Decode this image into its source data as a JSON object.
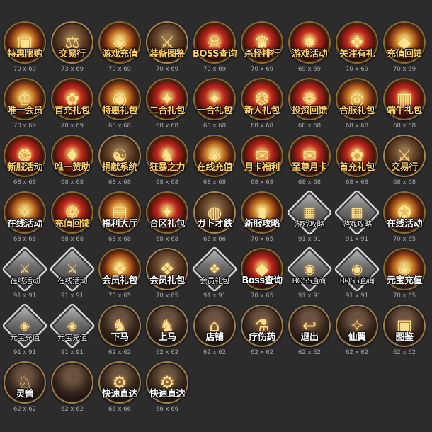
{
  "icons": [
    {
      "label": "特惠限购",
      "size": "70 x 69",
      "style": "gold",
      "glyph": "▣",
      "label_style": "gold"
    },
    {
      "label": "交易行",
      "size": "73 x 69",
      "style": "bronze",
      "glyph": "⚖",
      "label_style": "gold"
    },
    {
      "label": "游戏充值",
      "size": "70 x 69",
      "style": "gold",
      "glyph": "◈",
      "label_style": "gold"
    },
    {
      "label": "装备图鉴",
      "size": "70 x 69",
      "style": "bronze",
      "glyph": "⚔",
      "label_style": "gold"
    },
    {
      "label": "BOSS查询",
      "size": "70 x 69",
      "style": "red",
      "glyph": "☠",
      "label_style": "gold"
    },
    {
      "label": "杀怪排行",
      "size": "70 x 69",
      "style": "red",
      "glyph": "♛",
      "label_style": "gold"
    },
    {
      "label": "游戏活动",
      "size": "69 x 69",
      "style": "red",
      "glyph": "✹",
      "label_style": "gold"
    },
    {
      "label": "关注有礼",
      "size": "70 x 69",
      "style": "red",
      "glyph": "❖",
      "label_style": "gold"
    },
    {
      "label": "充值回馈",
      "size": "70 x 69",
      "style": "gold",
      "glyph": "◆",
      "label_style": "gold"
    },
    {
      "label": "唯一会员",
      "size": "70 x 69",
      "style": "gold",
      "glyph": "♔",
      "label_style": "gold"
    },
    {
      "label": "首充礼包",
      "size": "70 x 69",
      "style": "red",
      "glyph": "✿",
      "label_style": "gold"
    },
    {
      "label": "特惠礼包",
      "size": "68 x 68",
      "style": "gold",
      "glyph": "◉",
      "label_style": "gold"
    },
    {
      "label": "二合礼包",
      "size": "68 x 68",
      "style": "red",
      "glyph": "✦",
      "label_style": "gold"
    },
    {
      "label": "一合礼包",
      "size": "68 x 68",
      "style": "red",
      "glyph": "✦",
      "label_style": "gold"
    },
    {
      "label": "新人礼包",
      "size": "68 x 68",
      "style": "red",
      "glyph": "❂",
      "label_style": "gold"
    },
    {
      "label": "投资回馈",
      "size": "68 x 68",
      "style": "red",
      "glyph": "❁",
      "label_style": "gold"
    },
    {
      "label": "合服礼包",
      "size": "68 x 68",
      "style": "gold",
      "glyph": "◎",
      "label_style": "gold"
    },
    {
      "label": "端午礼包",
      "size": "68 x 68",
      "style": "red",
      "glyph": "▥",
      "label_style": "gold"
    },
    {
      "label": "新服活动",
      "size": "68 x 68",
      "style": "red",
      "glyph": "❂",
      "label_style": "gold"
    },
    {
      "label": "唯一赞助",
      "size": "68 x 68",
      "style": "red",
      "glyph": "♦",
      "label_style": "gold"
    },
    {
      "label": "捐献系统",
      "size": "68 x 68",
      "style": "bronze",
      "glyph": "☯",
      "label_style": "gold"
    },
    {
      "label": "狂暴之力",
      "size": "68 x 68",
      "style": "red",
      "glyph": "♞",
      "label_style": "gold"
    },
    {
      "label": "在线充值",
      "size": "68 x 68",
      "style": "gold",
      "glyph": "◈",
      "label_style": "gold"
    },
    {
      "label": "月卡福利",
      "size": "68 x 68",
      "style": "red",
      "glyph": "✉",
      "label_style": "gold"
    },
    {
      "label": "至尊月卡",
      "size": "68 x 68",
      "style": "red",
      "glyph": "✉",
      "label_style": "gold"
    },
    {
      "label": "首充礼包",
      "size": "68 x 68",
      "style": "red",
      "glyph": "✿",
      "label_style": "gold"
    },
    {
      "label": "交易行",
      "size": "68 x 68",
      "style": "bronze",
      "glyph": "⚔",
      "label_style": "gold"
    },
    {
      "label": "在线活动",
      "size": "68 x 68",
      "style": "gold",
      "glyph": "✧",
      "label_style": "white"
    },
    {
      "label": "充值回馈",
      "size": "68 x 68",
      "style": "red",
      "glyph": "❁",
      "label_style": "gold"
    },
    {
      "label": "福利大厅",
      "size": "68 x 68",
      "style": "gold",
      "glyph": "▤",
      "label_style": "white"
    },
    {
      "label": "合区礼包",
      "size": "68 x 68",
      "style": "red",
      "glyph": "✦",
      "label_style": "white"
    },
    {
      "label": "ガ卜オ鉄",
      "size": "66 x 66",
      "style": "bronze",
      "glyph": "◍",
      "label_style": "white"
    },
    {
      "label": "新服攻略",
      "size": "70 x 65",
      "style": "gold",
      "glyph": "▮",
      "label_style": "white"
    },
    {
      "label": "游戏攻略",
      "size": "91 x 91",
      "style": "silver",
      "glyph": "▦",
      "label_style": "small"
    },
    {
      "label": "游戏攻略",
      "size": "91 x 91",
      "style": "silver",
      "glyph": "▦",
      "label_style": "small"
    },
    {
      "label": "在线活动",
      "size": "70 x 65",
      "style": "gold",
      "glyph": "✪",
      "label_style": "white"
    },
    {
      "label": "在线活动",
      "size": "91 x 91",
      "style": "silver",
      "glyph": "⚔",
      "label_style": "small"
    },
    {
      "label": "在线活动",
      "size": "91 x 91",
      "style": "silver",
      "glyph": "⚔",
      "label_style": "small"
    },
    {
      "label": "会员礼包",
      "size": "70 x 65",
      "style": "gold",
      "glyph": "❖",
      "label_style": "white"
    },
    {
      "label": "会员礼包",
      "size": "70 x 65",
      "style": "bronze",
      "glyph": "❖",
      "label_style": "white"
    },
    {
      "label": "会员礼包",
      "size": "91 x 91",
      "style": "silver",
      "glyph": "❖",
      "label_style": "small"
    },
    {
      "label": "Boss查询",
      "size": "70 x 65",
      "style": "red",
      "glyph": "◆",
      "label_style": "white"
    },
    {
      "label": "BOSS查询",
      "size": "91 x 91",
      "style": "silver",
      "glyph": "◉",
      "label_style": "small"
    },
    {
      "label": "BOSS查询",
      "size": "91 x 91",
      "style": "silver",
      "glyph": "◉",
      "label_style": "small"
    },
    {
      "label": "元宝充值",
      "size": "70 x 65",
      "style": "gold",
      "glyph": "◈",
      "label_style": "white"
    },
    {
      "label": "元宝充值",
      "size": "91 x 91",
      "style": "silver",
      "glyph": "◈",
      "label_style": "small"
    },
    {
      "label": "元宝充值",
      "size": "91 x 91",
      "style": "silver",
      "glyph": "◈",
      "label_style": "small"
    },
    {
      "label": "下马",
      "size": "62 x 62",
      "style": "dark",
      "glyph": "♞",
      "label_style": "white"
    },
    {
      "label": "上马",
      "size": "62 x 62",
      "style": "dark",
      "glyph": "♞",
      "label_style": "white"
    },
    {
      "label": "店铺",
      "size": "62 x 62",
      "style": "dark",
      "glyph": "⌂",
      "label_style": "white"
    },
    {
      "label": "疗伤药",
      "size": "62 x 62",
      "style": "dark",
      "glyph": "⚗",
      "label_style": "white"
    },
    {
      "label": "退出",
      "size": "62 x 62",
      "style": "dark",
      "glyph": "↩",
      "label_style": "white"
    },
    {
      "label": "仙翼",
      "size": "62 x 62",
      "style": "dark",
      "glyph": "✧",
      "label_style": "white"
    },
    {
      "label": "图鉴",
      "size": "62 x 62",
      "style": "dark",
      "glyph": "▣",
      "label_style": "white"
    },
    {
      "label": "灵兽",
      "size": "62 x 62",
      "style": "dark",
      "glyph": "♘",
      "label_style": "white"
    },
    {
      "label": "",
      "size": "62 x 62",
      "style": "dark",
      "glyph": "",
      "label_style": "white"
    },
    {
      "label": "快速直达",
      "size": "66 x 66",
      "style": "dark",
      "glyph": "⚙",
      "label_style": "white"
    },
    {
      "label": "快速直达",
      "size": "66 x 66",
      "style": "dark",
      "glyph": "⚙",
      "label_style": "white"
    }
  ]
}
